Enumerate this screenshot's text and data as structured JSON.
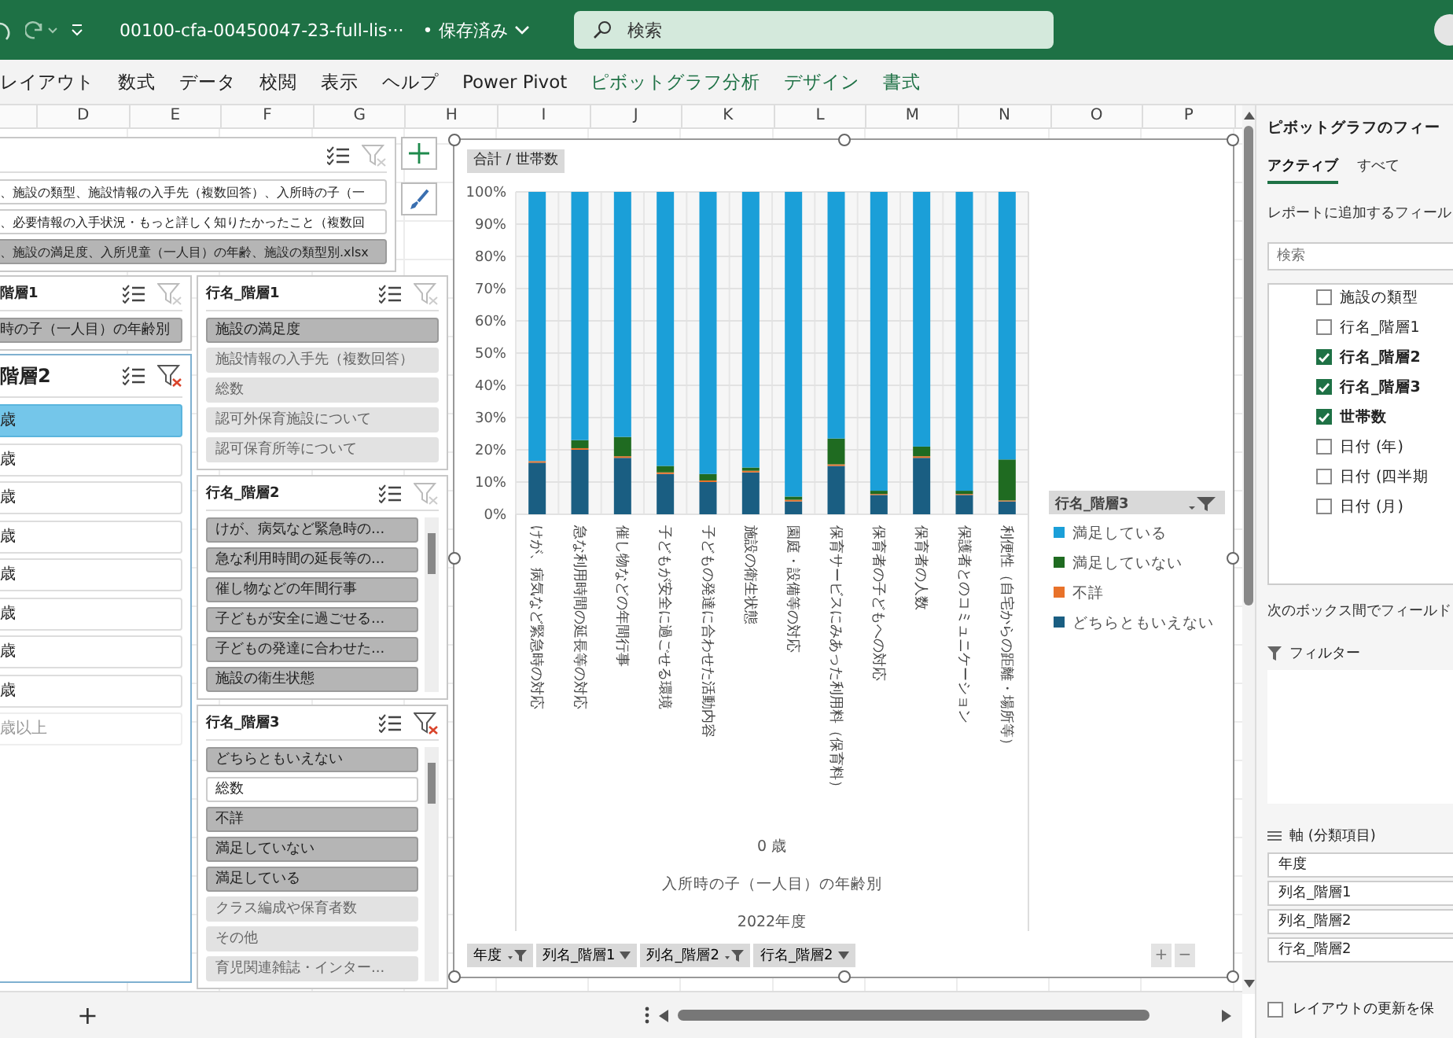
{
  "title_bar": {
    "file_name": "00100-cfa-00450047-23-full-lis···",
    "save_status": "• 保存済み",
    "search": {
      "placeholder": "検索"
    }
  },
  "ribbon_tabs": [
    {
      "label": "レイアウト",
      "contextual": false
    },
    {
      "label": "数式",
      "contextual": false
    },
    {
      "label": "データ",
      "contextual": false
    },
    {
      "label": "校閲",
      "contextual": false
    },
    {
      "label": "表示",
      "contextual": false
    },
    {
      "label": "ヘルプ",
      "contextual": false
    },
    {
      "label": "Power Pivot",
      "contextual": false
    },
    {
      "label": "ピボットグラフ分析",
      "contextual": true
    },
    {
      "label": "デザイン",
      "contextual": true
    },
    {
      "label": "書式",
      "contextual": true
    }
  ],
  "column_headers": [
    "D",
    "E",
    "F",
    "G",
    "H",
    "I",
    "J",
    "K",
    "L",
    "M",
    "N",
    "O",
    "P"
  ],
  "file_slicer": {
    "filtered": false,
    "active": false,
    "scrollable": false,
    "items": [
      {
        "label": "、施設の類型、施設情報の入手先（複数回答）、入所時の子（一",
        "selected": false,
        "has_data": true
      },
      {
        "label": "、必要情報の入手状況・もっと詳しく知りたかったこと（複数回",
        "selected": false,
        "has_data": true
      },
      {
        "label": "、施設の満足度、入所児童（一人目）の年齢、施設の類型別.xlsx",
        "selected": true,
        "has_data": true
      }
    ]
  },
  "column_slicers": [
    {
      "title": "階層1",
      "filtered": false,
      "active": false,
      "scrollable": false,
      "items": [
        {
          "label": "時の子（一人目）の年齢別",
          "selected": true,
          "has_data": true
        }
      ]
    },
    {
      "title": "階層2",
      "filtered": true,
      "active": true,
      "scrollable": false,
      "items": [
        {
          "label": "歳",
          "selected": true,
          "has_data": true
        },
        {
          "label": "歳",
          "selected": false,
          "has_data": true
        },
        {
          "label": "歳",
          "selected": false,
          "has_data": true
        },
        {
          "label": "歳",
          "selected": false,
          "has_data": true
        },
        {
          "label": "歳",
          "selected": false,
          "has_data": true
        },
        {
          "label": "歳",
          "selected": false,
          "has_data": true
        },
        {
          "label": "歳",
          "selected": false,
          "has_data": true
        },
        {
          "label": "歳",
          "selected": false,
          "has_data": true
        },
        {
          "label": "歳以上",
          "selected": false,
          "has_data": false
        }
      ]
    }
  ],
  "row_slicers": [
    {
      "title": "行名_階層1",
      "filtered": false,
      "active": false,
      "scrollable": false,
      "items": [
        {
          "label": "施設の満足度",
          "selected": true,
          "has_data": true
        },
        {
          "label": "施設情報の入手先（複数回答）",
          "selected": false,
          "has_data": false
        },
        {
          "label": "総数",
          "selected": false,
          "has_data": false
        },
        {
          "label": "認可外保育施設について",
          "selected": false,
          "has_data": false
        },
        {
          "label": "認可保育所等について",
          "selected": false,
          "has_data": false
        }
      ]
    },
    {
      "title": "行名_階層2",
      "filtered": false,
      "active": false,
      "scrollable": true,
      "items": [
        {
          "label": "けが、病気など緊急時の...",
          "selected": true,
          "has_data": true
        },
        {
          "label": "急な利用時間の延長等の...",
          "selected": true,
          "has_data": true
        },
        {
          "label": "催し物などの年間行事",
          "selected": true,
          "has_data": true
        },
        {
          "label": "子どもが安全に過ごせる...",
          "selected": true,
          "has_data": true
        },
        {
          "label": "子どもの発達に合わせた...",
          "selected": true,
          "has_data": true
        },
        {
          "label": "施設の衛生状態",
          "selected": true,
          "has_data": true
        }
      ]
    },
    {
      "title": "行名_階層3",
      "filtered": true,
      "active": false,
      "scrollable": true,
      "items": [
        {
          "label": "どちらともいえない",
          "selected": true,
          "has_data": true
        },
        {
          "label": "総数",
          "selected": false,
          "has_data": true
        },
        {
          "label": "不詳",
          "selected": true,
          "has_data": true
        },
        {
          "label": "満足していない",
          "selected": true,
          "has_data": true
        },
        {
          "label": "満足している",
          "selected": true,
          "has_data": true
        },
        {
          "label": "クラス編成や保育者数",
          "selected": false,
          "has_data": false
        },
        {
          "label": "その他",
          "selected": false,
          "has_data": false
        },
        {
          "label": "育児関連雑誌・インター...",
          "selected": false,
          "has_data": false
        }
      ]
    }
  ],
  "chart": {
    "value_field": "合計 / 世帯数",
    "chart_data": {
      "type": "bar",
      "stacked": true,
      "grid": true,
      "legend": "right",
      "categories": [
        "けが、病気など緊急時の対応",
        "急な利用時間の延長等の対応",
        "催し物などの年間行事",
        "子どもが安全に過ごせる環境",
        "子どもの発達に合わせた活動内容",
        "施設の衛生状態",
        "園庭・設備等の対応",
        "保育サービスにみあった利用料（保育料）",
        "保育者の子どもへの対応",
        "保育者の人数",
        "保護者とのコミュニケーション",
        "利便性（自宅からの距離・場所等）"
      ],
      "ylim": [
        0,
        100
      ],
      "yticks": [
        {
          "value": 0,
          "label": "0%"
        },
        {
          "value": 10,
          "label": "10%"
        },
        {
          "value": 20,
          "label": "20%"
        },
        {
          "value": 30,
          "label": "30%"
        },
        {
          "value": 40,
          "label": "40%"
        },
        {
          "value": 50,
          "label": "50%"
        },
        {
          "value": 60,
          "label": "60%"
        },
        {
          "value": 70,
          "label": "70%"
        },
        {
          "value": 80,
          "label": "80%"
        },
        {
          "value": 90,
          "label": "90%"
        },
        {
          "value": 100,
          "label": "100%"
        }
      ],
      "series": [
        {
          "name": "どちらともいえない",
          "color": "#1a5e82",
          "values": [
            16,
            20,
            17.5,
            12.5,
            10,
            13,
            4,
            15,
            6,
            17.5,
            6,
            4
          ]
        },
        {
          "name": "不詳",
          "color": "#e8722a",
          "values": [
            0.5,
            0.5,
            0.5,
            0.5,
            0.5,
            0.5,
            0.5,
            0.5,
            0.3,
            0.5,
            0.3,
            0.3
          ]
        },
        {
          "name": "満足していない",
          "color": "#1f6b21",
          "values": [
            0,
            2.5,
            6,
            2,
            2,
            1,
            1,
            8,
            1,
            3,
            1,
            12.7
          ]
        },
        {
          "name": "満足している",
          "color": "#1b9fd8",
          "values": [
            83.5,
            77,
            76,
            85,
            87.5,
            85.5,
            94.5,
            76.5,
            92.7,
            79,
            92.7,
            83
          ]
        }
      ]
    },
    "axis_labels": [
      "0 歳",
      "入所時の子（一人目）の年齢別",
      "2022年度"
    ],
    "legend_title": "行名_階層3",
    "field_buttons": [
      {
        "label": "年度",
        "filtered": true
      },
      {
        "label": "列名_階層1",
        "filtered": false
      },
      {
        "label": "列名_階層2",
        "filtered": true
      },
      {
        "label": "行名_階層2",
        "filtered": false
      }
    ],
    "zoom_buttons": [
      "+",
      "−"
    ]
  },
  "field_pane": {
    "title": "ピボットグラフのフィー",
    "tabs": [
      {
        "label": "アクティブ",
        "selected": true
      },
      {
        "label": "すべて",
        "selected": false
      }
    ],
    "hint": "レポートに追加するフィール",
    "search": {
      "placeholder": "検索"
    },
    "fields": [
      {
        "label": "施設の類型",
        "checked": false
      },
      {
        "label": "行名_階層1",
        "checked": false
      },
      {
        "label": "行名_階層2",
        "checked": true
      },
      {
        "label": "行名_階層3",
        "checked": true
      },
      {
        "label": "世帯数",
        "checked": true
      },
      {
        "label": "日付 (年)",
        "checked": false
      },
      {
        "label": "日付 (四半期",
        "checked": false
      },
      {
        "label": "日付 (月)",
        "checked": false
      }
    ],
    "areas_hint": "次のボックス間でフィールド",
    "filter_area": {
      "title": "フィルター"
    },
    "axis_area": {
      "title": "軸 (分類項目)",
      "items": [
        "年度",
        "列名_階層1",
        "列名_階層2",
        "行名_階層2"
      ]
    },
    "defer_update": {
      "label": "レイアウトの更新を保",
      "checked": false
    }
  },
  "sheet_bar": {
    "add_sheet": "+"
  }
}
